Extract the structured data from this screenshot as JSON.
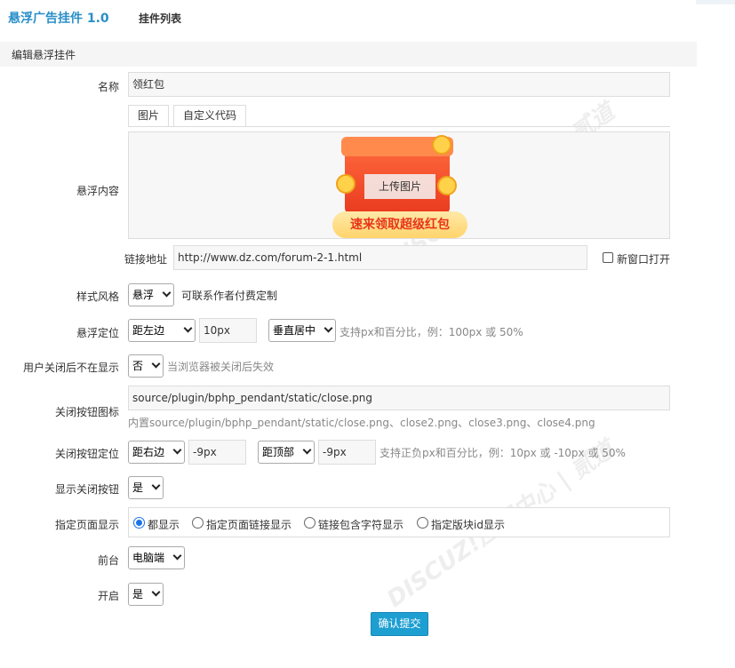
{
  "header": {
    "app_title": "悬浮广告挂件 1.0",
    "nav_link": "挂件列表"
  },
  "section": {
    "title": "编辑悬浮挂件"
  },
  "form": {
    "name_label": "名称",
    "name_value": "领红包",
    "content_label": "悬浮内容",
    "tabs": [
      "图片",
      "自定义代码"
    ],
    "banner_text": "速来领取超级红包",
    "upload_button": "上传图片",
    "link_label": "链接地址",
    "link_value": "http://www.dz.com/forum-2-1.html",
    "new_window_label": "新窗口打开",
    "style_label": "样式风格",
    "style_value": "悬浮",
    "style_hint": "可联系作者付费定制",
    "position_label": "悬浮定位",
    "position_h_value": "距左边",
    "position_offset_value": "10px",
    "position_v_value": "垂直居中",
    "position_hint": "支持px和百分比，例：100px 或 50%",
    "close_hide_label": "用户关闭后不在显示",
    "close_hide_value": "否",
    "close_hide_hint": "当浏览器被关闭后失效",
    "close_icon_label": "关闭按钮图标",
    "close_icon_value": "source/plugin/bphp_pendant/static/close.png",
    "close_icon_hint": "内置source/plugin/bphp_pendant/static/close.png、close2.png、close3.png、close4.png",
    "close_pos_label": "关闭按钮定位",
    "close_pos_h_value": "距右边",
    "close_pos_h_offset": "-9px",
    "close_pos_v_value": "距顶部",
    "close_pos_v_offset": "-9px",
    "close_pos_hint": "支持正负px和百分比，例：10px 或 -10px 或 50%",
    "show_close_label": "显示关闭按钮",
    "show_close_value": "是",
    "page_display_label": "指定页面显示",
    "page_display_options": [
      "都显示",
      "指定页面链接显示",
      "链接包含字符显示",
      "指定版块id显示"
    ],
    "frontend_label": "前台",
    "frontend_value": "电脑端",
    "enable_label": "开启",
    "enable_value": "是",
    "submit_label": "确认提交"
  },
  "colors": {
    "accent": "#2a8fc8",
    "submit": "#1e9fd2",
    "radio_checked": "#1a73e8"
  }
}
